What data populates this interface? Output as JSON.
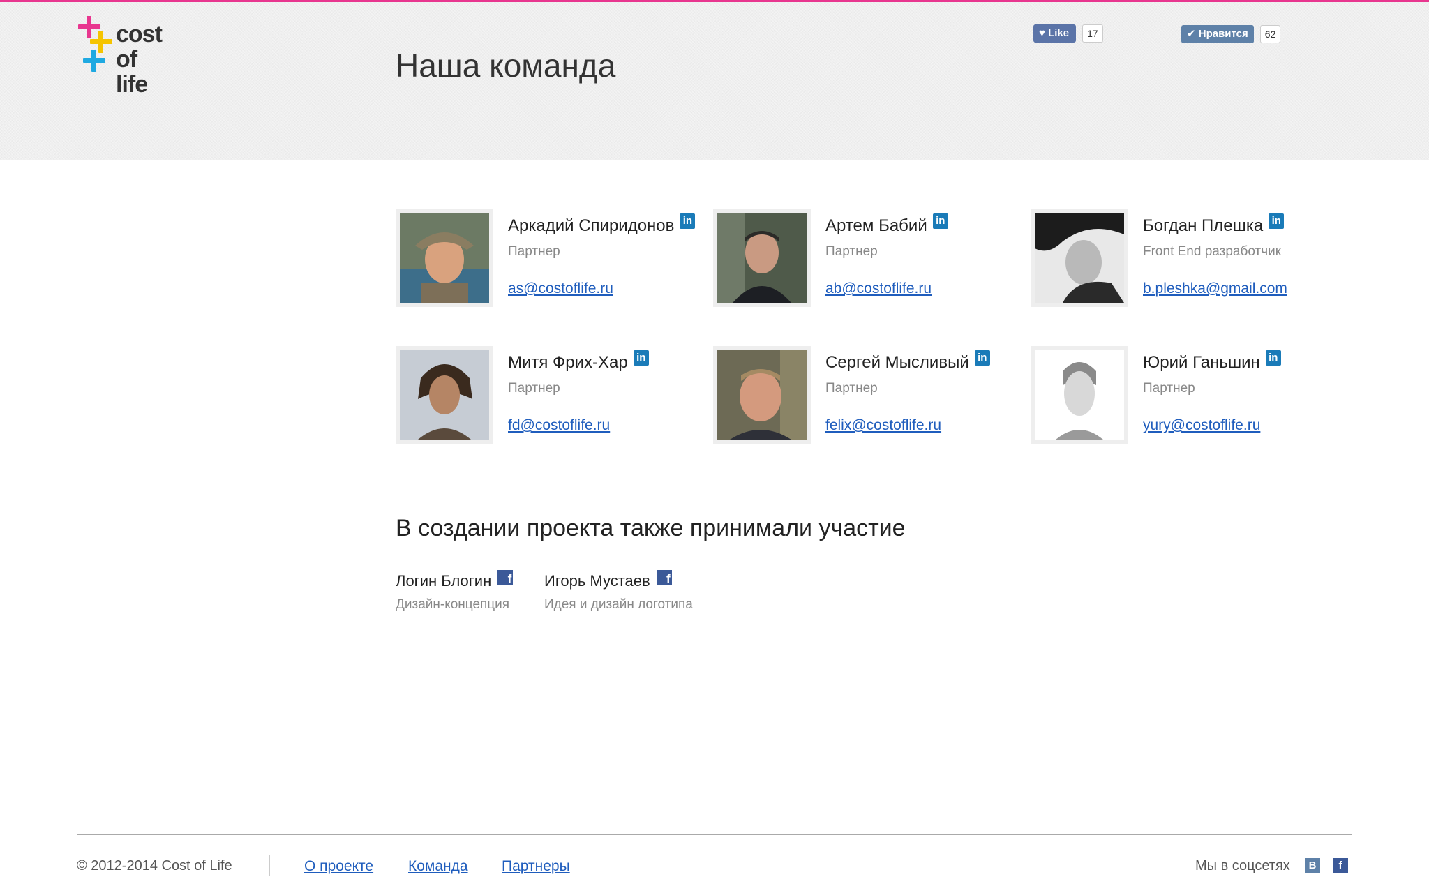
{
  "header": {
    "logo_text": [
      "cost",
      "of",
      "life"
    ],
    "title": "Наша команда",
    "fb_like": {
      "label": "Like",
      "count": "17"
    },
    "vk_like": {
      "label": "Нравится",
      "count": "62"
    }
  },
  "team": [
    {
      "name": "Аркадий Спиридонов",
      "role": "Партнер",
      "email": "as@costoflife.ru"
    },
    {
      "name": "Артем Бабий",
      "role": "Партнер",
      "email": "ab@costoflife.ru"
    },
    {
      "name": "Богдан Плешка",
      "role": "Front End разработчик",
      "email": "b.pleshka@gmail.com"
    },
    {
      "name": "Митя Фрих-Хар",
      "role": "Партнер",
      "email": "fd@costoflife.ru"
    },
    {
      "name": "Сергей Мысливый",
      "role": "Партнер",
      "email": "felix@costoflife.ru"
    },
    {
      "name": "Юрий Ганьшин",
      "role": "Партнер",
      "email": "yury@costoflife.ru"
    }
  ],
  "contributors_title": "В создании проекта также принимали участие",
  "contributors": [
    {
      "name": "Логин Блогин",
      "role": "Дизайн-концепция"
    },
    {
      "name": "Игорь Мустаев",
      "role": "Идея и дизайн логотипа"
    }
  ],
  "footer": {
    "copyright": "© 2012-2014 Cost of Life",
    "links": [
      "О проекте",
      "Команда",
      "Партнеры"
    ],
    "social_label": "Мы в соцсетях"
  },
  "colors": {
    "accent": "#e8368f",
    "link": "#1f5dbd",
    "linkedin": "#1a7bb8",
    "facebook": "#3b5998",
    "vk": "#5e81a8"
  },
  "icons": [
    "linkedin-icon",
    "facebook-icon",
    "vk-icon",
    "heart-icon",
    "check-icon"
  ]
}
